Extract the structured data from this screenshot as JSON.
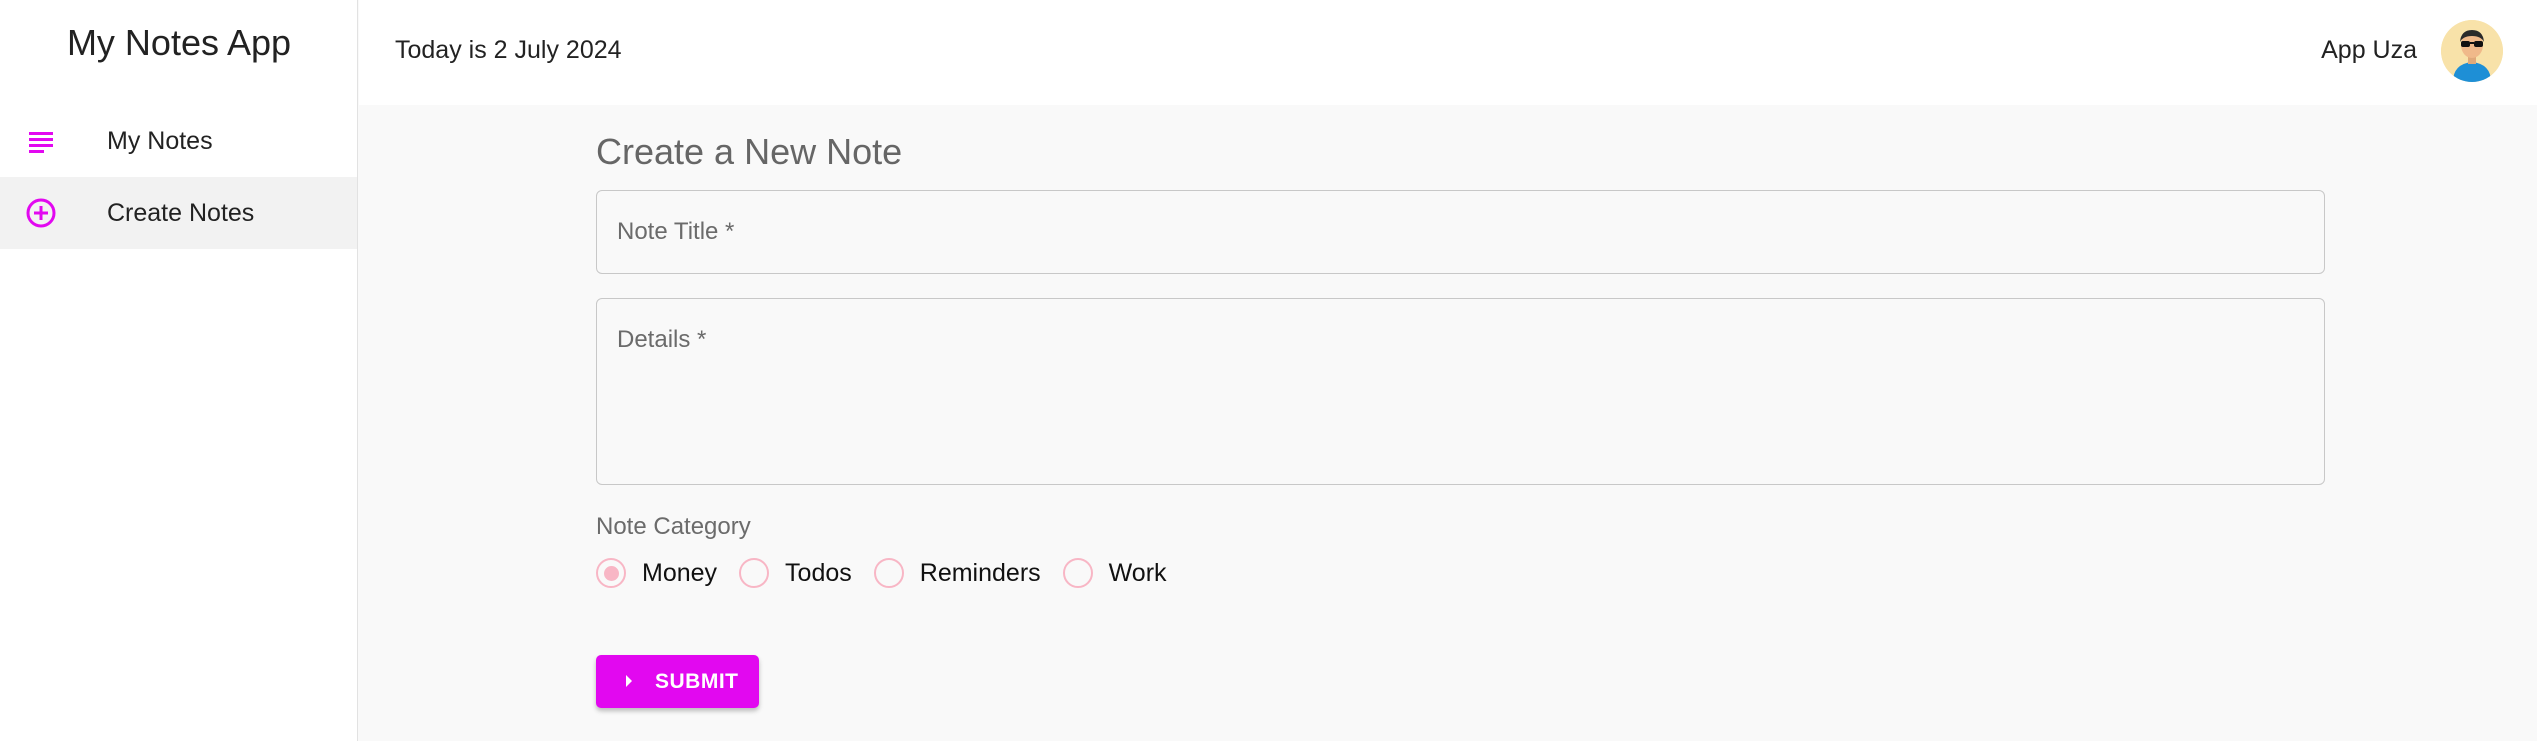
{
  "app": {
    "title": "My Notes App"
  },
  "nav": {
    "items": [
      {
        "label": "My Notes",
        "icon": "subject-icon",
        "active": false
      },
      {
        "label": "Create Notes",
        "icon": "add-circle-outline-icon",
        "active": true
      }
    ]
  },
  "header": {
    "date_text": "Today is 2 July 2024",
    "user_name": "App Uza"
  },
  "form": {
    "heading": "Create a New Note",
    "title_field": {
      "label": "Note Title *",
      "value": ""
    },
    "details_field": {
      "label": "Details *",
      "value": ""
    },
    "category": {
      "label": "Note Category",
      "selected": "Money",
      "options": [
        "Money",
        "Todos",
        "Reminders",
        "Work"
      ]
    },
    "submit_label": "SUBMIT"
  },
  "colors": {
    "accent": "#e208f0",
    "radio": "#f8b6c5"
  }
}
